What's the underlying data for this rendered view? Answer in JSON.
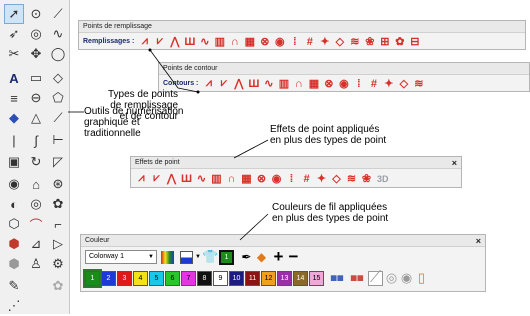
{
  "fill_panel": {
    "title": "Points de remplissage",
    "row_label": "Remplissages :",
    "icon_names": [
      "zigzag-fill-icon",
      "zigzag-fill-2-icon",
      "zigzag-fill-3-icon",
      "pattern-fill-icon",
      "wave-fill-icon",
      "weave-fill-icon",
      "arch-fill-icon",
      "cross-hatch-fill-icon",
      "braid-fill-icon",
      "ring-fill-icon",
      "dots-fill-icon",
      "grid-fill-icon",
      "stars-fill-icon",
      "diamond-fill-icon",
      "spiral-fill-icon",
      "flower-fill-icon",
      "lattice-fill-icon",
      "flower-2-fill-icon",
      "pattern-2-fill-icon"
    ]
  },
  "outline_panel": {
    "title": "Points de contour",
    "row_label": "Contours :",
    "icon_names": [
      "dashed-outline-icon",
      "double-dash-outline-icon",
      "arrow-outline-icon",
      "diamonds-outline-icon",
      "zigzag-outline-icon",
      "wave-outline-icon",
      "crown-outline-icon",
      "satin-outline-icon",
      "triangle-outline-icon",
      "pattern-outline-icon",
      "loop-outline-icon",
      "bean-outline-icon",
      "wave-2-outline-icon",
      "stripe-outline-icon",
      "circle-outline-icon"
    ]
  },
  "effects_panel": {
    "title": "Effets de point",
    "close": "×",
    "icon_names": [
      "grid-effect-icon",
      "curve-effect-icon",
      "ripple-effect-icon",
      "angle-effect-icon",
      "fan-effect-icon",
      "peak-effect-icon",
      "tent-effect-icon",
      "tent-2-effect-icon",
      "mountain-effect-icon",
      "wave-effect-icon",
      "bars-effect-icon",
      "stripes-effect-icon",
      "swirl-effect-icon",
      "flower-effect-icon",
      "comb-effect-icon",
      "hand-effect-icon"
    ],
    "three_d": "3D"
  },
  "color_panel": {
    "title": "Couleur",
    "close": "×",
    "colorway": "Colorway 1",
    "number_badge": "1",
    "swatches": [
      {
        "n": "1",
        "c": "#1a8c1a",
        "t": "#ffffff"
      },
      {
        "n": "2",
        "c": "#1c3ad6",
        "t": "#ffffff"
      },
      {
        "n": "3",
        "c": "#e01818",
        "t": "#ffffff"
      },
      {
        "n": "4",
        "c": "#f2e21a",
        "t": "#000000"
      },
      {
        "n": "5",
        "c": "#19c8e8",
        "t": "#000000"
      },
      {
        "n": "6",
        "c": "#28c728",
        "t": "#000000"
      },
      {
        "n": "7",
        "c": "#e038e0",
        "t": "#000000"
      },
      {
        "n": "8",
        "c": "#111111",
        "t": "#ffffff"
      },
      {
        "n": "9",
        "c": "#ffffff",
        "t": "#000000"
      },
      {
        "n": "10",
        "c": "#1b1b80",
        "t": "#ffffff"
      },
      {
        "n": "11",
        "c": "#8c1414",
        "t": "#ffffff"
      },
      {
        "n": "12",
        "c": "#f0a020",
        "t": "#000000"
      },
      {
        "n": "13",
        "c": "#9b2fa8",
        "t": "#ffffff"
      },
      {
        "n": "14",
        "c": "#8a6a2a",
        "t": "#ffffff"
      },
      {
        "n": "15",
        "c": "#f0a8d8",
        "t": "#000000"
      }
    ]
  },
  "callouts": {
    "types": "Types de points\nde remplissage\net de contour",
    "tools": "Outils de numérisation\ngraphique et\ntraditionnelle",
    "effects": "Effets de point appliqués\nen plus des types de point",
    "colors": "Couleurs de fil appliquées\nen plus des types de point"
  },
  "colors": {
    "stitch_red": "#d8302a",
    "accent_blue": "#2a4fb8",
    "title_bg": "#e9e9e9"
  }
}
